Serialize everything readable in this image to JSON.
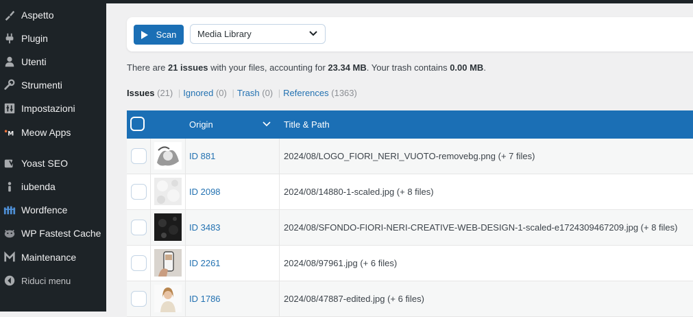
{
  "sidebar": {
    "items": [
      {
        "label": "Aspetto",
        "icon": "paintbrush-icon"
      },
      {
        "label": "Plugin",
        "icon": "plugin-icon"
      },
      {
        "label": "Utenti",
        "icon": "users-icon"
      },
      {
        "label": "Strumenti",
        "icon": "wrench-icon"
      },
      {
        "label": "Impostazioni",
        "icon": "settings-icon"
      },
      {
        "label": "Meow Apps",
        "icon": "meow-apps-icon"
      },
      {
        "label": "Yoast SEO",
        "icon": "yoast-icon"
      },
      {
        "label": "iubenda",
        "icon": "iubenda-icon"
      },
      {
        "label": "Wordfence",
        "icon": "wordfence-icon"
      },
      {
        "label": "WP Fastest Cache",
        "icon": "cheetah-icon"
      },
      {
        "label": "Maintenance",
        "icon": "maintenance-icon"
      },
      {
        "label": "Riduci menu",
        "icon": "collapse-icon"
      }
    ]
  },
  "toolbar": {
    "scan_label": "Scan",
    "source_value": "Media Library"
  },
  "summary": {
    "prefix": "There are ",
    "issues": "21 issues",
    "middle": " with your files, accounting for ",
    "size": "23.34 MB",
    "trash_text": ". Your trash contains ",
    "trash_size": "0.00 MB",
    "suffix": "."
  },
  "filters": {
    "issues_label": "Issues",
    "issues_count": "(21)",
    "ignored_label": "Ignored",
    "ignored_count": "(0)",
    "trash_label": "Trash",
    "trash_count": "(0)",
    "references_label": "References",
    "references_count": "(1363)",
    "separator": "|"
  },
  "table": {
    "headers": {
      "origin": "Origin",
      "title_path": "Title & Path"
    },
    "rows": [
      {
        "origin": "ID 881",
        "path": "2024/08/LOGO_FIORI_NERI_VUOTO-removebg.png (+ 7 files)"
      },
      {
        "origin": "ID 2098",
        "path": "2024/08/14880-1-scaled.jpg (+ 8 files)"
      },
      {
        "origin": "ID 3483",
        "path": "2024/08/SFONDO-FIORI-NERI-CREATIVE-WEB-DESIGN-1-scaled-e1724309467209.jpg (+ 8 files)"
      },
      {
        "origin": "ID 2261",
        "path": "2024/08/97961.jpg (+ 6 files)"
      },
      {
        "origin": "ID 1786",
        "path": "2024/08/47887-edited.jpg (+ 6 files)"
      }
    ]
  },
  "colors": {
    "sidebar_bg": "#1d2327",
    "accent": "#1b6fb5",
    "link": "#2271b1"
  }
}
